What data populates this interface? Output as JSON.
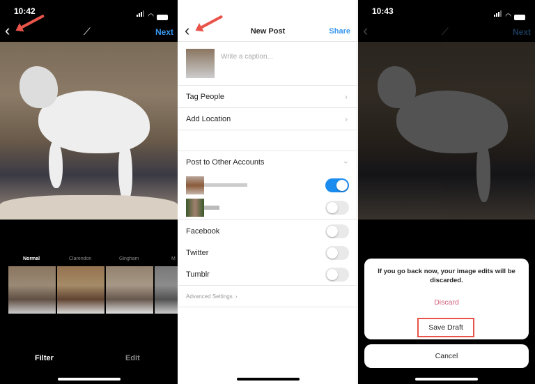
{
  "panel1": {
    "status_time": "10:42",
    "next_label": "Next",
    "filters": [
      "Normal",
      "Clarendon",
      "Gingham",
      "M"
    ],
    "tabs": [
      "Filter",
      "Edit"
    ]
  },
  "panel2": {
    "title": "New Post",
    "share_label": "Share",
    "caption_placeholder": "Write a caption...",
    "tag_people": "Tag People",
    "add_location": "Add Location",
    "post_to_other": "Post to Other Accounts",
    "accounts": [
      {
        "enabled": true
      },
      {
        "enabled": false
      }
    ],
    "services": [
      {
        "label": "Facebook",
        "enabled": false
      },
      {
        "label": "Twitter",
        "enabled": false
      },
      {
        "label": "Tumblr",
        "enabled": false
      }
    ],
    "advanced_settings": "Advanced Settings"
  },
  "panel3": {
    "status_time": "10:43",
    "next_label": "Next",
    "dialog_message": "If you go back now, your image edits will be discarded.",
    "discard_label": "Discard",
    "save_draft_label": "Save Draft",
    "cancel_label": "Cancel"
  },
  "colors": {
    "accent_blue": "#3897f0",
    "toggle_on": "#1a8cf0",
    "discard": "#d0607a",
    "highlight": "#e8544a"
  }
}
